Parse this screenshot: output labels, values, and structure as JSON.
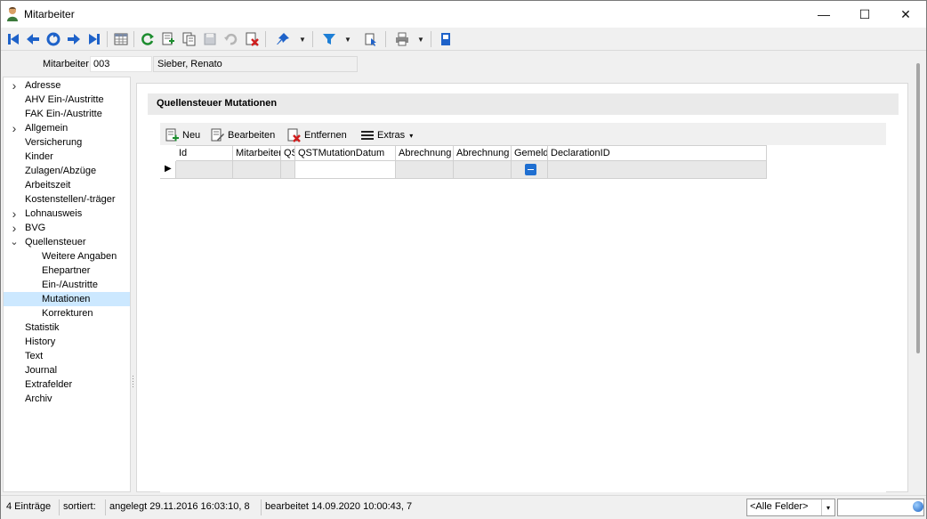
{
  "window": {
    "title": "Mitarbeiter",
    "controls": {
      "minimize": "—",
      "maximize": "☐",
      "close": "✕"
    }
  },
  "toolbar": {
    "icons": [
      "first-record-icon",
      "previous-record-icon",
      "jump-icon",
      "next-record-icon",
      "last-record-icon",
      "table-view-icon",
      "refresh-icon",
      "new-record-icon",
      "copy-record-icon",
      "save-icon",
      "undo-icon",
      "delete-record-icon",
      "pin-icon",
      "filter-icon",
      "query-icon",
      "print-icon",
      "document-icon"
    ]
  },
  "employee": {
    "label": "Mitarbeiter",
    "id": "003",
    "name": "Sieber, Renato"
  },
  "tree": {
    "items": [
      {
        "label": "Adresse",
        "arrow": "›",
        "indent": 0
      },
      {
        "label": "AHV Ein-/Austritte",
        "arrow": "",
        "indent": 0
      },
      {
        "label": "FAK Ein-/Austritte",
        "arrow": "",
        "indent": 0
      },
      {
        "label": "Allgemein",
        "arrow": "›",
        "indent": 0
      },
      {
        "label": "Versicherung",
        "arrow": "",
        "indent": 0
      },
      {
        "label": "Kinder",
        "arrow": "",
        "indent": 0
      },
      {
        "label": "Zulagen/Abzüge",
        "arrow": "",
        "indent": 0
      },
      {
        "label": "Arbeitszeit",
        "arrow": "",
        "indent": 0
      },
      {
        "label": "Kostenstellen/-träger",
        "arrow": "",
        "indent": 0
      },
      {
        "label": "Lohnausweis",
        "arrow": "›",
        "indent": 0
      },
      {
        "label": "BVG",
        "arrow": "›",
        "indent": 0
      },
      {
        "label": "Quellensteuer",
        "arrow": "⌄",
        "indent": 0
      },
      {
        "label": "Weitere Angaben",
        "arrow": "",
        "indent": 1
      },
      {
        "label": "Ehepartner",
        "arrow": "",
        "indent": 1
      },
      {
        "label": "Ein-/Austritte",
        "arrow": "",
        "indent": 1
      },
      {
        "label": "Mutationen",
        "arrow": "",
        "indent": 1,
        "selected": true
      },
      {
        "label": "Korrekturen",
        "arrow": "",
        "indent": 1
      },
      {
        "label": "Statistik",
        "arrow": "",
        "indent": 0
      },
      {
        "label": "History",
        "arrow": "",
        "indent": 0
      },
      {
        "label": "Text",
        "arrow": "",
        "indent": 0
      },
      {
        "label": "Journal",
        "arrow": "",
        "indent": 0
      },
      {
        "label": "Extrafelder",
        "arrow": "",
        "indent": 0
      },
      {
        "label": "Archiv",
        "arrow": "",
        "indent": 0
      }
    ]
  },
  "main": {
    "group_title": "Quellensteuer Mutationen",
    "grid_toolbar": {
      "new_label": "Neu",
      "edit_label": "Bearbeiten",
      "remove_label": "Entfernen",
      "extras_label": "Extras",
      "extras_arrow": "▾"
    },
    "columns": [
      "Id",
      "Mitarbeiter",
      "QS",
      "QSTMutationDatum",
      "Abrechnung",
      "Abrechnung",
      "Gemeldet",
      "DeclarationID"
    ],
    "row_indicator": "▶"
  },
  "statusbar": {
    "entries": "4 Einträge",
    "sorted": "sortiert:",
    "created": "angelegt 29.11.2016 16:03:10,  8",
    "edited": "bearbeitet 14.09.2020 10:00:43,  7",
    "field_filter": "<Alle Felder>",
    "combo_arrow": "▾"
  },
  "colors": {
    "selection": "#cce8ff",
    "accent_blue": "#1f6fd1"
  }
}
